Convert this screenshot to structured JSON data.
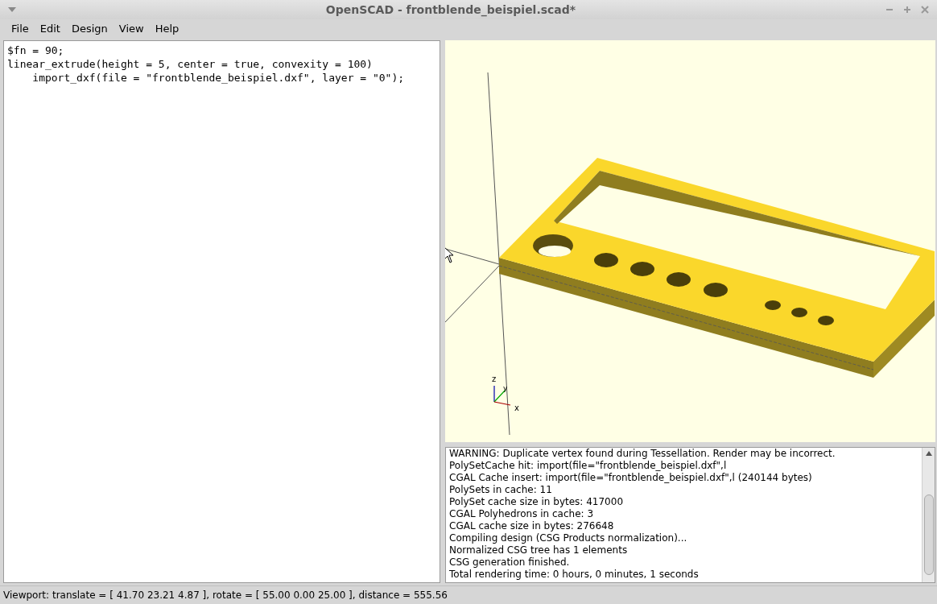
{
  "window": {
    "title": "OpenSCAD - frontblende_beispiel.scad*"
  },
  "menu": [
    {
      "label": "File"
    },
    {
      "label": "Edit"
    },
    {
      "label": "Design"
    },
    {
      "label": "View"
    },
    {
      "label": "Help"
    }
  ],
  "editor": {
    "lines": [
      "$fn = 90;",
      "linear_extrude(height = 5, center = true, convexity = 100)",
      "    import_dxf(file = \"frontblende_beispiel.dxf\", layer = \"0\");"
    ]
  },
  "viewport": {
    "axis_labels": [
      "z",
      "y",
      "x"
    ]
  },
  "console": {
    "lines": [
      "WARNING: Duplicate vertex found during Tessellation. Render may be incorrect.",
      "PolySetCache hit: import(file=\"frontblende_beispiel.dxf\",l",
      "CGAL Cache insert: import(file=\"frontblende_beispiel.dxf\",l (240144 bytes)",
      "PolySets in cache: 11",
      "PolySet cache size in bytes: 417000",
      "CGAL Polyhedrons in cache: 3",
      "CGAL cache size in bytes: 276648",
      "Compiling design (CSG Products normalization)...",
      "Normalized CSG tree has 1 elements",
      "CSG generation finished.",
      "Total rendering time: 0 hours, 0 minutes, 1 seconds"
    ]
  },
  "status_bar": "Viewport: translate = [ 41.70 23.21 4.87 ], rotate = [ 55.00 0.00 25.00 ], distance = 555.56"
}
